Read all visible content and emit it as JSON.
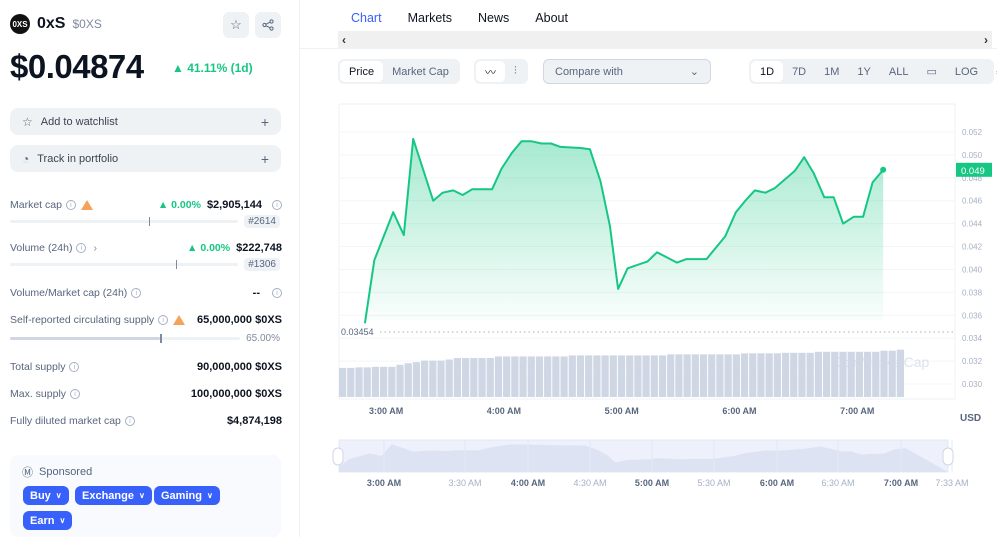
{
  "coin": {
    "name": "0xS",
    "symbol": "$0XS",
    "logo_text": "0XS",
    "price": "$0.04874",
    "change": "▲ 41.11% (1d)"
  },
  "actions": {
    "watchlist": "Add to watchlist",
    "portfolio": "Track in portfolio"
  },
  "stats": {
    "market_cap": {
      "label": "Market cap",
      "change": "▲ 0.00%",
      "value": "$2,905,144",
      "rank": "#2614",
      "bar_fraction": 0.61
    },
    "volume": {
      "label": "Volume (24h)",
      "change": "▲ 0.00%",
      "value": "$222,748",
      "rank": "#1306",
      "bar_fraction": 0.73
    },
    "vol_mcap": {
      "label": "Volume/Market cap (24h)",
      "value": "--"
    },
    "circ_supply": {
      "label": "Self-reported circulating supply",
      "value": "65,000,000 $0XS",
      "percent": "65.00%",
      "fraction": 0.65
    },
    "total_supply": {
      "label": "Total supply",
      "value": "90,000,000 $0XS"
    },
    "max_supply": {
      "label": "Max. supply",
      "value": "100,000,000 $0XS"
    },
    "fdmc": {
      "label": "Fully diluted market cap",
      "value": "$4,874,198"
    }
  },
  "sponsored": {
    "label": "Sponsored",
    "chips": [
      "Buy",
      "Exchange",
      "Gaming",
      "Earn"
    ]
  },
  "tabs": [
    "Chart",
    "Markets",
    "News",
    "About"
  ],
  "toolbar": {
    "type": [
      "Price",
      "Market Cap"
    ],
    "compare": "Compare with",
    "ranges": [
      "1D",
      "7D",
      "1M",
      "1Y",
      "ALL"
    ],
    "log": "LOG"
  },
  "chart_data": {
    "type": "area",
    "title": "",
    "xlabel": "",
    "ylabel": "USD",
    "currency": "USD",
    "ylim": [
      0.029,
      0.053
    ],
    "yticks": [
      "0.052",
      "0.050",
      "0.048",
      "0.046",
      "0.044",
      "0.042",
      "0.040",
      "0.038",
      "0.036",
      "0.034",
      "0.032",
      "0.030"
    ],
    "ytick_values": [
      0.052,
      0.05,
      0.048,
      0.046,
      0.044,
      0.042,
      0.04,
      0.038,
      0.036,
      0.034,
      0.032,
      0.03
    ],
    "xticks": [
      "3:00 AM",
      "4:00 AM",
      "5:00 AM",
      "6:00 AM",
      "7:00 AM"
    ],
    "xtick_hours": [
      3,
      4,
      5,
      6,
      7
    ],
    "xlim_hours": [
      2.6,
      7.83
    ],
    "current_price_label": "0.049",
    "open_price_label": "0.03454",
    "open_price": 0.03454,
    "x_hours": [
      2.82,
      2.9,
      3.06,
      3.15,
      3.23,
      3.4,
      3.48,
      3.57,
      3.65,
      3.73,
      3.9,
      3.98,
      4.07,
      4.15,
      4.23,
      4.32,
      4.4,
      4.48,
      4.65,
      4.73,
      4.82,
      4.9,
      4.97,
      5.05,
      5.22,
      5.3,
      5.47,
      5.55,
      5.72,
      5.88,
      5.97,
      6.05,
      6.13,
      6.22,
      6.3,
      6.47,
      6.55,
      6.63,
      6.72,
      6.8,
      6.88,
      6.97,
      7.05,
      7.13,
      7.22
    ],
    "values": [
      0.0353,
      0.0408,
      0.045,
      0.043,
      0.0514,
      0.046,
      0.0467,
      0.0469,
      0.0465,
      0.047,
      0.047,
      0.0488,
      0.0502,
      0.0512,
      0.0512,
      0.051,
      0.051,
      0.0507,
      0.0506,
      0.0505,
      0.0477,
      0.0438,
      0.0383,
      0.0401,
      0.0407,
      0.0415,
      0.0406,
      0.0409,
      0.0409,
      0.0429,
      0.045,
      0.046,
      0.0469,
      0.0467,
      0.0471,
      0.0486,
      0.0498,
      0.0484,
      0.0463,
      0.0463,
      0.044,
      0.0446,
      0.0446,
      0.0476,
      0.0487
    ],
    "volume_relative": [
      0.56,
      0.56,
      0.57,
      0.57,
      0.58,
      0.58,
      0.58,
      0.62,
      0.65,
      0.67,
      0.7,
      0.7,
      0.7,
      0.72,
      0.75,
      0.75,
      0.75,
      0.75,
      0.75,
      0.78,
      0.78,
      0.78,
      0.78,
      0.78,
      0.78,
      0.78,
      0.78,
      0.78,
      0.8,
      0.8,
      0.8,
      0.8,
      0.8,
      0.8,
      0.8,
      0.8,
      0.8,
      0.8,
      0.8,
      0.8,
      0.82,
      0.82,
      0.82,
      0.82,
      0.82,
      0.82,
      0.82,
      0.82,
      0.82,
      0.84,
      0.84,
      0.84,
      0.84,
      0.84,
      0.85,
      0.85,
      0.85,
      0.85,
      0.87,
      0.87,
      0.87,
      0.87,
      0.87,
      0.87,
      0.87,
      0.87,
      0.89,
      0.89,
      0.91
    ],
    "navigator_ticks": [
      "3:00 AM",
      "3:30 AM",
      "4:00 AM",
      "4:30 AM",
      "5:00 AM",
      "5:30 AM",
      "6:00 AM",
      "6:30 AM",
      "7:00 AM",
      "7:33 AM"
    ],
    "navigator_bold": [
      true,
      false,
      true,
      false,
      true,
      false,
      true,
      false,
      true,
      false
    ],
    "watermark": "CoinMarketCap"
  }
}
